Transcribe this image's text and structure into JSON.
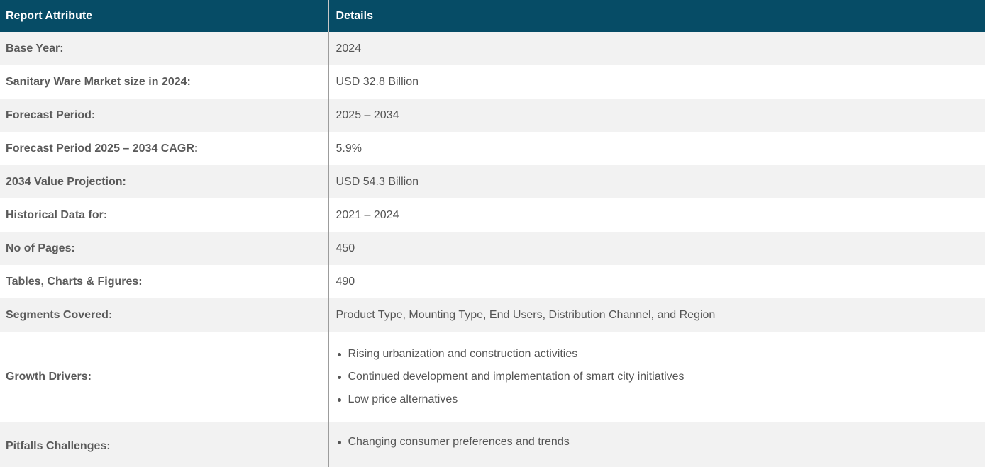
{
  "header": {
    "attribute": "Report Attribute",
    "details": "Details"
  },
  "rows": [
    {
      "label": "Base Year:",
      "value": "2024"
    },
    {
      "label": "Sanitary Ware Market size in 2024:",
      "value": "USD 32.8 Billion"
    },
    {
      "label": "Forecast Period:",
      "value": "2025 – 2034"
    },
    {
      "label": "Forecast Period 2025 – 2034 CAGR:",
      "value": "5.9%"
    },
    {
      "label": "2034 Value Projection:",
      "value": "USD 54.3 Billion"
    },
    {
      "label": "Historical Data for:",
      "value": "2021 – 2024"
    },
    {
      "label": "No of Pages:",
      "value": "450"
    },
    {
      "label": "Tables, Charts & Figures:",
      "value": "490"
    },
    {
      "label": "Segments Covered:",
      "value": "Product Type, Mounting Type, End Users, Distribution Channel, and Region"
    }
  ],
  "growth_drivers": {
    "label": "Growth Drivers:",
    "items": [
      "Rising urbanization and construction activities",
      "Continued development and implementation of smart city initiatives",
      "Low price alternatives"
    ]
  },
  "pitfalls": {
    "label": "Pitfalls Challenges:",
    "items": [
      "Changing consumer preferences and trends"
    ]
  },
  "colors": {
    "header_bg": "#064c66",
    "header_text": "#ffffff",
    "row_alt_bg": "#f2f2f2",
    "text": "#555555"
  }
}
